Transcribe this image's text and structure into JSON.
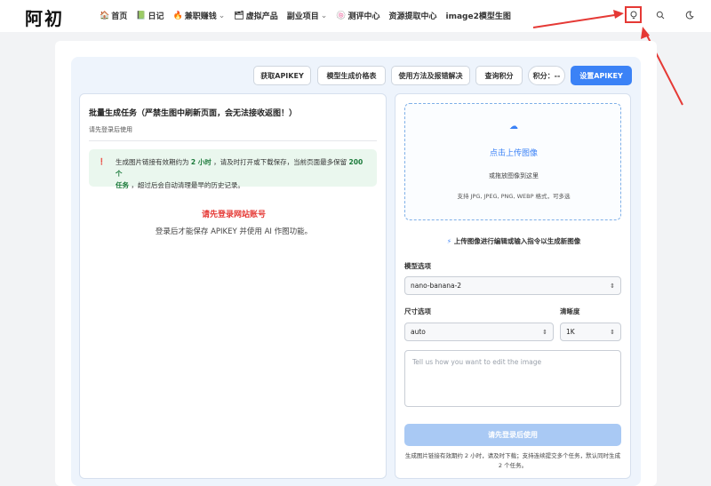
{
  "header": {
    "logo": "阿初",
    "nav": [
      {
        "icon": "🏠",
        "label": "首页",
        "dropdown": false
      },
      {
        "icon": "📗",
        "label": "日记",
        "dropdown": false
      },
      {
        "icon": "🔥",
        "label": "兼职赚钱",
        "dropdown": true
      },
      {
        "icon": "🗂",
        "label": "虚拟产品",
        "dropdown": false
      },
      {
        "icon": "",
        "label": "副业项目",
        "dropdown": true
      },
      {
        "icon": "🍥",
        "label": "测评中心",
        "dropdown": false
      },
      {
        "icon": "",
        "label": "资源提取中心",
        "dropdown": false
      },
      {
        "icon": "",
        "label": "image2模型生图",
        "dropdown": false
      }
    ],
    "icons": {
      "bulb": "lightbulb-icon",
      "search": "search-icon",
      "theme": "moon-icon"
    }
  },
  "toolbar": {
    "get_apikey": "获取APIKEY",
    "price_table": "模型生成价格表",
    "usage": "使用方法及报错解决",
    "query_points": "查询积分",
    "points_label": "积分：",
    "points_value": "--",
    "set_apikey": "设置APIKEY"
  },
  "left_panel": {
    "title": "批量生成任务（严禁生图中刷新页面，会无法接收返图！）",
    "subtitle": "请先登录后使用",
    "notice_pre": "生成图片链接有效期约为",
    "notice_bold1": "2 小时",
    "notice_mid": "，请及时打开或下载保存，当前页面最多保留",
    "notice_bold2": "200 个",
    "notice_bold3": "任务",
    "notice_post": "，超过后会自动清理最早的历史记录。",
    "login_warning": "请先登录网站账号",
    "login_desc": "登录后才能保存 APIKEY 并使用 AI 作图功能。"
  },
  "right_panel": {
    "upload_title": "点击上传图像",
    "upload_sub": "或拖放图像到这里",
    "upload_formats": "支持 JPG, JPEG, PNG, WEBP 格式，可多选",
    "hint": "上传图像进行编辑或输入指令以生成新图像",
    "model_label": "模型选项",
    "model_value": "nano-banana-2",
    "size_label": "尺寸选项",
    "size_value": "auto",
    "clarity_label": "清晰度",
    "clarity_value": "1K",
    "prompt_placeholder": "Tell us how you want to edit the image",
    "submit_label": "请先登录后使用",
    "footer": "生成图片链接有效期约 2 小时，请及时下载；支持连续提交多个任务，默认同时生成 2 个任务。"
  },
  "colors": {
    "accent": "#3b82f6",
    "warning": "#e53935",
    "highlight": "#e53935"
  }
}
